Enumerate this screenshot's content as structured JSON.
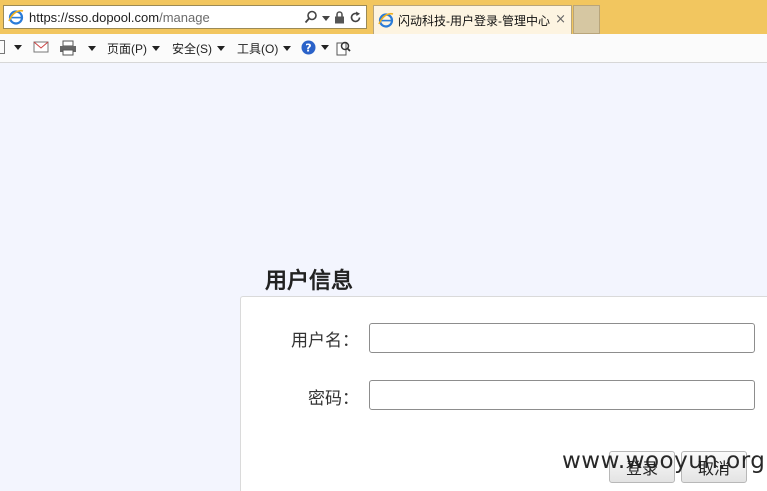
{
  "browser": {
    "address": {
      "scheme_host": "https://sso.dopool.com",
      "path": "/manage"
    },
    "active_tab_title": "闪动科技-用户登录-管理中心",
    "tab_close": "×"
  },
  "toolbar": {
    "page_label": "页面(P)",
    "safety_label": "安全(S)",
    "tools_label": "工具(O)"
  },
  "main": {
    "title": "用户信息",
    "username_label": "用户名：",
    "password_label": "密码：",
    "username_value": "",
    "password_value": "",
    "login_button": "登录",
    "cancel_button": "取消"
  },
  "watermark": "www.wooyun.org",
  "colors": {
    "browser_bar": "#f2c65f",
    "page_background": "#f3f5fe"
  }
}
